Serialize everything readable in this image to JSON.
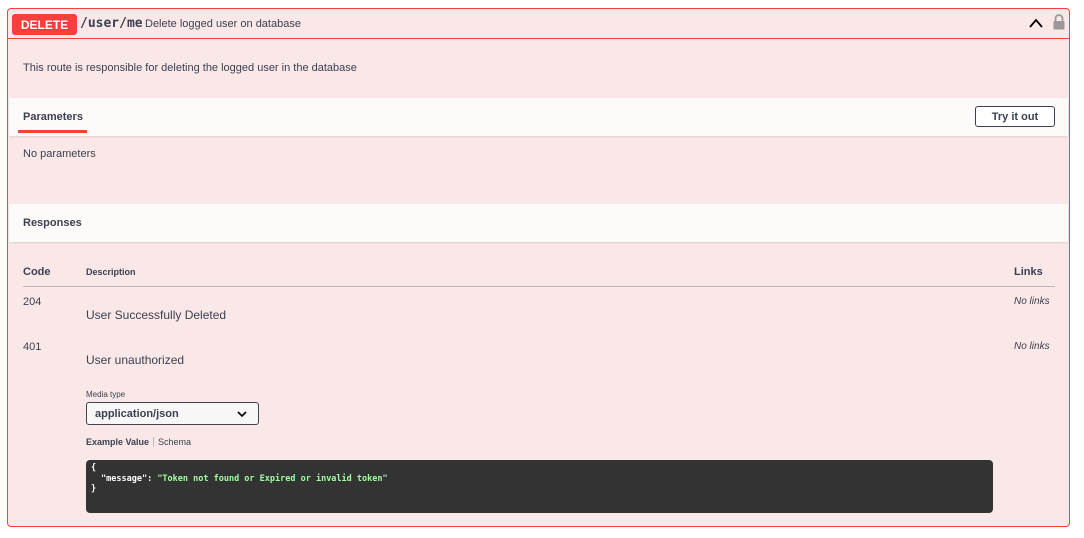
{
  "operation": {
    "method": "DELETE",
    "path": "/user/me",
    "summary": "Delete logged user on database",
    "description": "This route is responsible for deleting the logged user in the database",
    "colors": {
      "accent": "#f93e3e",
      "background": "#fae7e7"
    },
    "icons": {
      "collapse": "chevron-up-icon",
      "lock": "lock-icon"
    }
  },
  "parameters": {
    "tab_label": "Parameters",
    "try_button": "Try it out",
    "empty_text": "No parameters"
  },
  "responses": {
    "title": "Responses",
    "headers": {
      "code": "Code",
      "description": "Description",
      "links": "Links"
    },
    "rows": [
      {
        "code": "204",
        "description": "User Successfully Deleted",
        "links": "No links"
      },
      {
        "code": "401",
        "description": "User unauthorized",
        "links": "No links"
      }
    ],
    "media_type_label": "Media type",
    "media_type_value": "application/json",
    "example_tabs": {
      "example": "Example Value",
      "schema": "Schema"
    },
    "example": {
      "open": "{",
      "key": "\"message\"",
      "colon": ": ",
      "value": "\"Token not found or Expired or invalid token\"",
      "close": "}"
    }
  }
}
